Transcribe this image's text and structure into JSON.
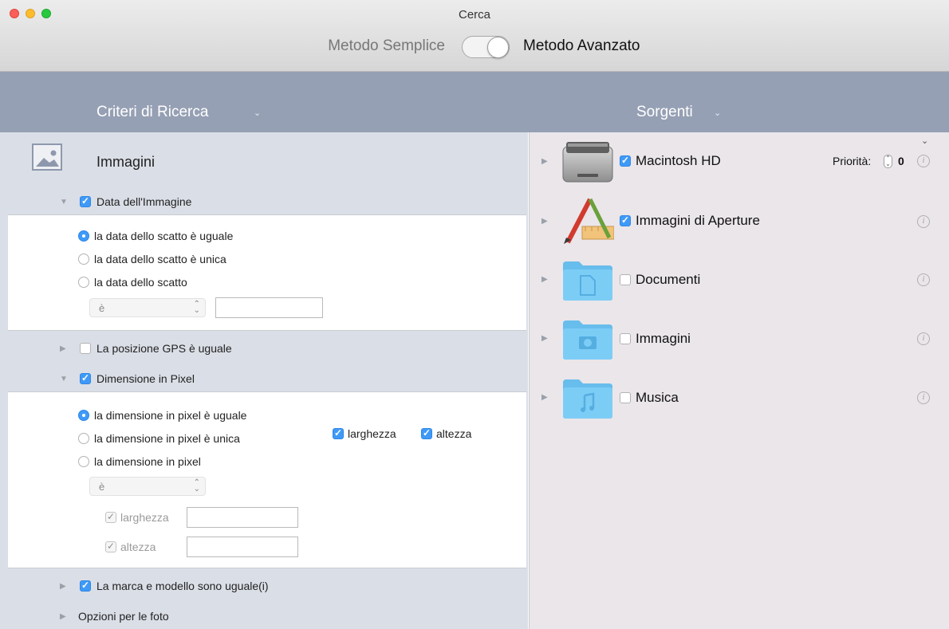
{
  "window": {
    "title": "Cerca"
  },
  "mode": {
    "simple_label": "Metodo Semplice",
    "advanced_label": "Metodo Avanzato",
    "advanced_on": true
  },
  "header": {
    "criteria_label": "Criteri di Ricerca",
    "sources_label": "Sorgenti"
  },
  "criteria": {
    "category": "Immagini",
    "image_date": {
      "label": "Data dell'Immagine",
      "checked": true,
      "expanded": true,
      "options": [
        "la data dello scatto è uguale",
        "la data dello scatto è unica",
        "la data dello scatto"
      ],
      "selected_option": 0,
      "operator": "è",
      "value": ""
    },
    "gps": {
      "label": "La posizione GPS è uguale",
      "checked": false,
      "expanded": false
    },
    "pixel_size": {
      "label": "Dimensione in Pixel",
      "checked": true,
      "expanded": true,
      "options": [
        "la dimensione in pixel è uguale",
        "la dimensione in pixel è unica",
        "la dimensione in pixel"
      ],
      "selected_option": 0,
      "width_label": "larghezza",
      "height_label": "altezza",
      "operator": "è",
      "sub_width_label": "larghezza",
      "sub_height_label": "altezza",
      "width_value": "",
      "height_value": ""
    },
    "make_model": {
      "label": "La marca e modello sono uguale(i)",
      "checked": true,
      "expanded": false
    },
    "photo_options": {
      "label": "Opzioni per le foto"
    }
  },
  "sources": {
    "priority_label": "Priorità:",
    "priority_value": "0",
    "items": [
      {
        "name": "Macintosh HD",
        "checked": true,
        "icon": "hard-drive-icon"
      },
      {
        "name": "Immagini di Aperture",
        "checked": true,
        "icon": "aperture-icon"
      },
      {
        "name": "Documenti",
        "checked": false,
        "icon": "documents-folder-icon"
      },
      {
        "name": "Immagini",
        "checked": false,
        "icon": "pictures-folder-icon"
      },
      {
        "name": "Musica",
        "checked": false,
        "icon": "music-folder-icon"
      }
    ]
  },
  "colors": {
    "accent": "#3f9af7",
    "header_bg": "#96a0b4",
    "folder": "#7ccdf6"
  }
}
